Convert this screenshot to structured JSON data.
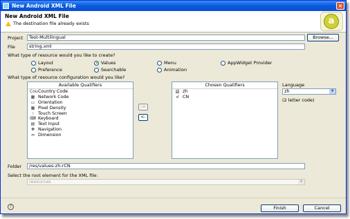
{
  "window": {
    "title": "New Android XML File",
    "close": "×"
  },
  "banner": {
    "title": "New Android XML File",
    "message": "The destination file already exists",
    "logo": "a"
  },
  "project": {
    "label": "Project",
    "value": "Test-Multilingual",
    "browse": "Browse..."
  },
  "file": {
    "label": "File",
    "value": "string.xml"
  },
  "resource_type": {
    "question": "What type of resource would you like to create?",
    "options": [
      "Layout",
      "Values",
      "Menu",
      "AppWidget Provider",
      "Preference",
      "Searchable",
      "Animation"
    ],
    "selected": "Values"
  },
  "config": {
    "question": "What type of resource configuration would you like?",
    "available_header": "Available Qualifiers",
    "available": [
      {
        "icon": "Cou",
        "label": "Country Code"
      },
      {
        "icon": "▦",
        "label": "Network Code"
      },
      {
        "icon": "▭",
        "label": "Orientation"
      },
      {
        "icon": "▦",
        "label": "Pixel Density"
      },
      {
        "icon": "☝",
        "label": "Touch Screen"
      },
      {
        "icon": "⌨",
        "label": "Keyboard"
      },
      {
        "icon": "▤",
        "label": "Text Input"
      },
      {
        "icon": "✥",
        "label": "Navigation"
      },
      {
        "icon": "⇔",
        "label": "Dimension"
      }
    ],
    "add_button": "->",
    "remove_button": "<-",
    "chosen_header": "Chosen Qualifiers",
    "chosen": [
      {
        "icon": "語",
        "label": "zh"
      },
      {
        "icon": "☌",
        "label": "CN"
      }
    ]
  },
  "language": {
    "label": "Language",
    "value": "zh",
    "hint": "(2 letter code)"
  },
  "folder": {
    "label": "Folder",
    "value": "/res/values-zh-rCN"
  },
  "root": {
    "label": "Select the root element for the XML file:",
    "value": "resources"
  },
  "footer": {
    "help": "?",
    "finish": "Finish",
    "cancel": "Cancel"
  }
}
